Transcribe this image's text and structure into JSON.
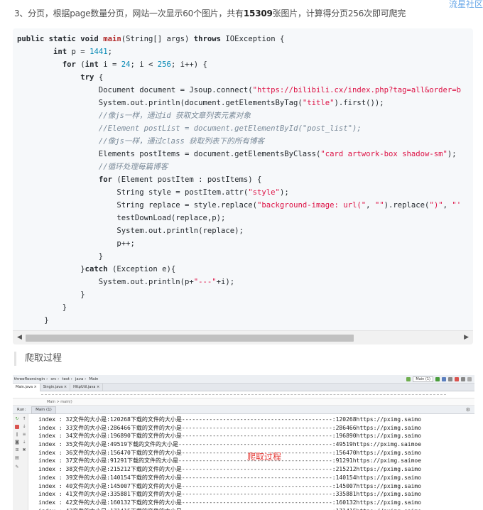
{
  "watermark": "流星社区",
  "note": {
    "prefix": "3、分页，根据page数量分页，网站一次显示60个图片，共有",
    "bold": "15309",
    "suffix": "张图片，计算得分页256次即可爬完"
  },
  "code_lines": [
    [
      [
        "kw",
        "public static void "
      ],
      [
        "fn",
        "main"
      ],
      [
        "",
        "(String[] args) "
      ],
      [
        "kw",
        "throws"
      ],
      [
        "",
        " IOException {"
      ]
    ],
    [
      [
        "",
        "        "
      ],
      [
        "kw",
        "int"
      ],
      [
        "",
        " p = "
      ],
      [
        "num",
        "1441"
      ],
      [
        "",
        ";"
      ]
    ],
    [
      [
        "",
        "          "
      ],
      [
        "kw",
        "for"
      ],
      [
        "",
        " ("
      ],
      [
        "kw",
        "int"
      ],
      [
        "",
        " i = "
      ],
      [
        "num",
        "24"
      ],
      [
        "",
        "; i < "
      ],
      [
        "num",
        "256"
      ],
      [
        "",
        "; i++) {"
      ]
    ],
    [
      [
        "",
        "              "
      ],
      [
        "kw",
        "try"
      ],
      [
        "",
        " {"
      ]
    ],
    [
      [
        "",
        "                  Document document = Jsoup.connect("
      ],
      [
        "str",
        "\"https://bilibili.cx/index.php?tag=all&order=b"
      ]
    ],
    [
      [
        "",
        "                  System.out.println(document.getElementsByTag("
      ],
      [
        "str",
        "\"title\""
      ],
      [
        "",
        ").first());"
      ]
    ],
    [
      [
        "",
        "                  "
      ],
      [
        "cmt",
        "//像js一样，通过id 获取文章列表元素对象"
      ]
    ],
    [
      [
        "",
        "                  "
      ],
      [
        "cmt",
        "//Element postList = document.getElementById(\"post_list\");"
      ]
    ],
    [
      [
        "",
        "                  "
      ],
      [
        "cmt",
        "//像js一样，通过class 获取列表下的所有博客"
      ]
    ],
    [
      [
        "",
        "                  Elements postItems = document.getElementsByClass("
      ],
      [
        "str",
        "\"card artwork-box shadow-sm\""
      ],
      [
        "",
        ");"
      ]
    ],
    [
      [
        "",
        "                  "
      ],
      [
        "cmt",
        "//循环处理每篇博客"
      ]
    ],
    [
      [
        "",
        "                  "
      ],
      [
        "kw",
        "for"
      ],
      [
        "",
        " (Element postItem : postItems) {"
      ]
    ],
    [
      [
        "",
        "                      String style = postItem.attr("
      ],
      [
        "str",
        "\"style\""
      ],
      [
        "",
        ");"
      ]
    ],
    [
      [
        "",
        "                      String replace = style.replace("
      ],
      [
        "str",
        "\"background-image: url(\""
      ],
      [
        "",
        ", "
      ],
      [
        "str",
        "\"\""
      ],
      [
        "",
        ").replace("
      ],
      [
        "str",
        "\")\""
      ],
      [
        "",
        ", "
      ],
      [
        "str",
        "\"'"
      ]
    ],
    [
      [
        "",
        "                      testDownLoad(replace,p);"
      ]
    ],
    [
      [
        "",
        "                      System.out.println(replace);"
      ]
    ],
    [
      [
        "",
        "                      p++;"
      ]
    ],
    [
      [
        "",
        "                  }"
      ]
    ],
    [
      [
        "",
        "              }"
      ],
      [
        "kw",
        "catch"
      ],
      [
        "",
        " (Exception e){"
      ]
    ],
    [
      [
        "",
        "                  System.out.println(p+"
      ],
      [
        "str",
        "\"---\""
      ],
      [
        "",
        "+i);"
      ]
    ],
    [
      [
        "",
        "              }"
      ]
    ],
    [
      [
        "",
        "          }"
      ]
    ],
    [
      [
        "",
        "      }"
      ]
    ]
  ],
  "section_title": "爬取过程",
  "ide": {
    "breadcrumbs": [
      "threefloorsingin",
      "src",
      "test",
      "java",
      "Main"
    ],
    "run_config": "Main (1)",
    "tabs": [
      "Main.java",
      "Singin.java",
      "HttpUtil.java"
    ],
    "sub_path": "Main  >  main()",
    "run_label": "Run:",
    "run_tab": "Main (1)",
    "console_lines": [
      "index : 32文件的大小是:120268下载的文件的大小是--------------------------------------------:120268https://pximg.saimo",
      "index : 33文件的大小是:286466下载的文件的大小是--------------------------------------------:286466https://pximg.saimo",
      "index : 34文件的大小是:196890下载的文件的大小是--------------------------------------------:196890https://pximg.saimo",
      "index : 35文件的大小是:49519下载的文件的大小是---------------------------------------------:49519https://pximg.saimoe",
      "index : 36文件的大小是:156470下载的文件的大小是--------------------------------------------:156470https://pximg.saimo",
      "index : 37文件的大小是:91291下载的文件的大小是---------------------------------------------:91291https://pximg.saimoe",
      "index : 38文件的大小是:215212下载的文件的大小是--------------------------------------------:215212https://pximg.saimo",
      "index : 39文件的大小是:140154下载的文件的大小是--------------------------------------------:140154https://pximg.saimo",
      "index : 40文件的大小是:145007下载的文件的大小是--------------------------------------------:145007https://pximg.saimo",
      "index : 41文件的大小是:335881下载的文件的大小是--------------------------------------------:335881https://pximg.saimo",
      "index : 42文件的大小是:160132下载的文件的大小是--------------------------------------------:160132https://pximg.saimo",
      "index : 43文件的大小是:171415下载的文件的大小是--------------------------------------------:171415https://pximg.saimo"
    ],
    "overlay_label": "爬取过程"
  }
}
